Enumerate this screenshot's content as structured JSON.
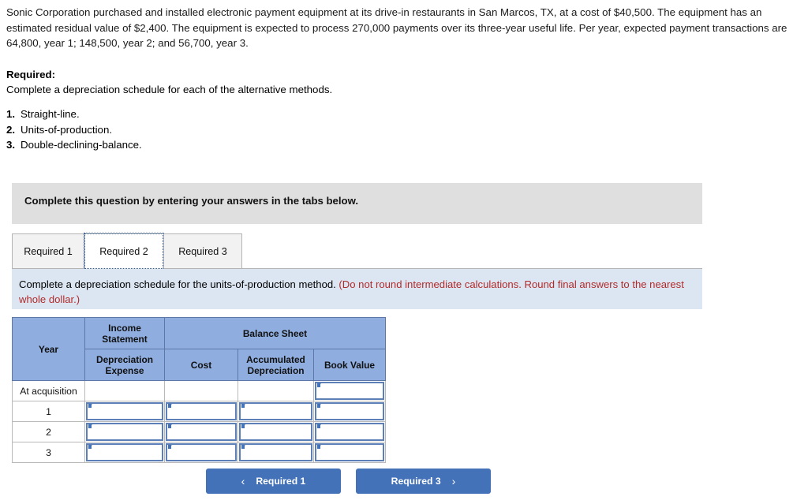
{
  "problem": {
    "statement": "Sonic Corporation purchased and installed electronic payment equipment at its drive-in restaurants in San Marcos, TX, at a cost of $40,500. The equipment has an estimated residual value of $2,400. The equipment is expected to process 270,000 payments over its three-year useful life. Per year, expected payment transactions are 64,800, year 1; 148,500, year 2; and 56,700, year 3.",
    "required_heading": "Required:",
    "required_text": "Complete a depreciation schedule for each of the alternative methods.",
    "methods": [
      {
        "num": "1.",
        "label": "Straight-line."
      },
      {
        "num": "2.",
        "label": "Units-of-production."
      },
      {
        "num": "3.",
        "label": "Double-declining-balance."
      }
    ]
  },
  "banner": {
    "text": "Complete this question by entering your answers in the tabs below."
  },
  "tabs": [
    {
      "label": "Required 1",
      "active": false
    },
    {
      "label": "Required 2",
      "active": true
    },
    {
      "label": "Required 3",
      "active": false
    }
  ],
  "instruction": {
    "main": "Complete a depreciation schedule for the units-of-production method. ",
    "note": "(Do not round intermediate calculations. Round final answers to the nearest whole dollar.)"
  },
  "table": {
    "header": {
      "year": "Year",
      "income_statement": "Income Statement",
      "balance_sheet": "Balance Sheet",
      "depreciation_expense": "Depreciation Expense",
      "cost": "Cost",
      "accumulated_depreciation": "Accumulated Depreciation",
      "book_value": "Book Value"
    },
    "rows": [
      {
        "label": "At acquisition",
        "depreciation_expense": "",
        "cost": "",
        "accumulated_depreciation": "",
        "book_value": ""
      },
      {
        "label": "1",
        "depreciation_expense": "",
        "cost": "",
        "accumulated_depreciation": "",
        "book_value": ""
      },
      {
        "label": "2",
        "depreciation_expense": "",
        "cost": "",
        "accumulated_depreciation": "",
        "book_value": ""
      },
      {
        "label": "3",
        "depreciation_expense": "",
        "cost": "",
        "accumulated_depreciation": "",
        "book_value": ""
      }
    ]
  },
  "nav": {
    "prev_label": "Required 1",
    "next_label": "Required 3",
    "prev_icon": "chevron-left-icon",
    "next_icon": "chevron-right-icon",
    "prev_glyph": "‹",
    "next_glyph": "›"
  },
  "colors": {
    "banner_gray": "#dfdfdf",
    "instruction_blue": "#dce6f2",
    "header_blue": "#8faddf",
    "input_border_blue": "#5c7fb8",
    "button_blue": "#4472b8",
    "note_red": "#b02b2b"
  }
}
